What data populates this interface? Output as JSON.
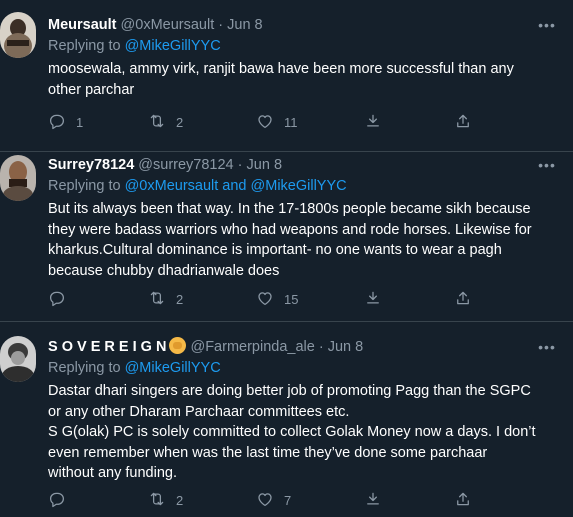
{
  "tweets": [
    {
      "name": "Meursault",
      "handle": "@0xMeursault",
      "dot": "·",
      "date": "Jun 8",
      "reply_prefix": "Replying to",
      "reply_to": "@MikeGillYYC",
      "lines": [
        "moosewala, ammy virk, ranjit bawa have been more successful than any",
        "other parchar"
      ],
      "replies": "1",
      "retweets": "2",
      "likes": "11"
    },
    {
      "name": "Surrey78124",
      "handle": "@surrey78124",
      "dot": "·",
      "date": "Jun 8",
      "reply_prefix": "Replying to",
      "reply_to": "@0xMeursault and @MikeGillYYC",
      "lines": [
        "But its always been that way. In the 17-1800s people became sikh because",
        "they were badass warriors who had weapons and rode horses. Likewise for",
        "kharkus.Cultural dominance is important- no one wants to wear a pagh",
        "because chubby dhadrianwale does"
      ],
      "replies": "",
      "retweets": "2",
      "likes": "15"
    },
    {
      "name": "S O V E R E I G N",
      "handle": "@Farmerpinda_ale",
      "dot": "·",
      "date": "Jun 8",
      "reply_prefix": "Replying to",
      "reply_to": "@MikeGillYYC",
      "lines": [
        "Dastar dhari singers are doing better job of promoting Pagg than the SGPC",
        "or any other Dharam Parchaar committees etc.",
        "S G(olak) PC is solely committed to collect Golak Money now a days. I don’t",
        "even remember when was the last time they’ve done some parchaar",
        "without any funding."
      ],
      "replies": "",
      "retweets": "2",
      "likes": "7"
    }
  ],
  "more_glyph": "•••",
  "icons": {
    "reply": "reply-icon",
    "retweet": "retweet-icon",
    "like": "heart-icon",
    "download": "download-icon",
    "share": "share-icon",
    "more": "more-icon",
    "emoji": "raised-fist-emoji"
  },
  "colors": {
    "background": "#15202b",
    "text": "#ffffff",
    "secondary": "#8b98a5",
    "link": "#1d9bf0",
    "divider": "#38444d"
  }
}
